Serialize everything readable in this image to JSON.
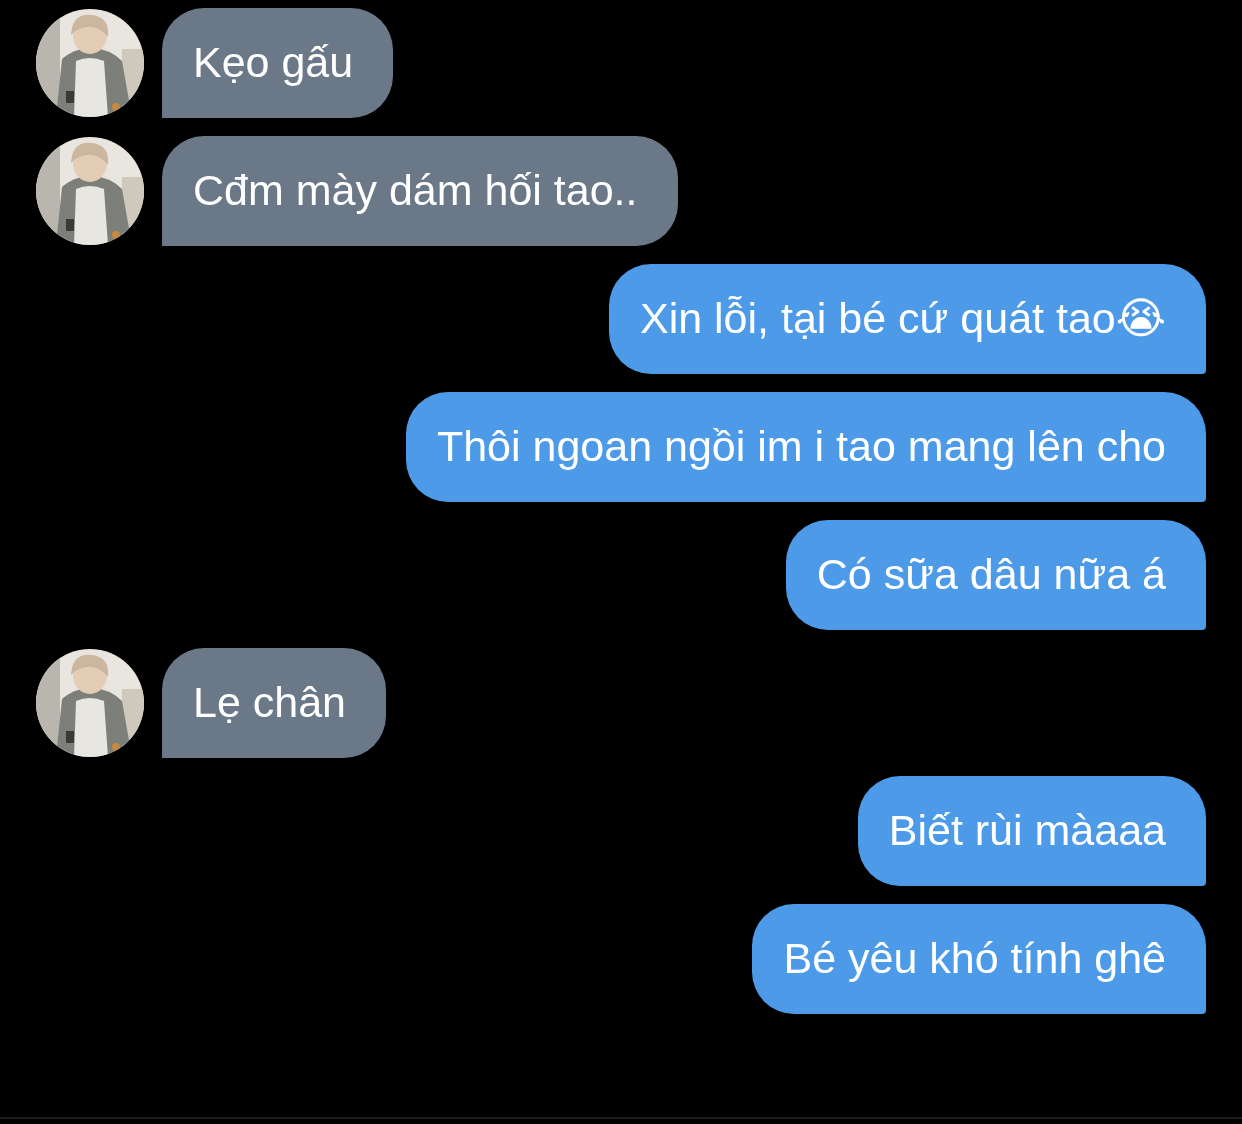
{
  "messages": [
    {
      "outgoing": false,
      "kind": "picture",
      "text": "Kẹo gấu"
    },
    {
      "outgoing": false,
      "kind": "picture",
      "text": "Cđm mày dám hối tao.."
    },
    {
      "outgoing": true,
      "text": "Xin lỗi, tại bé cứ quát tao😭"
    },
    {
      "outgoing": true,
      "text": "Thôi ngoan ngồi im i tao mang lên cho"
    },
    {
      "outgoing": true,
      "text": "Có sữa dâu nữa á"
    },
    {
      "outgoing": false,
      "kind": "picture",
      "text": "Lẹ chân"
    },
    {
      "outgoing": true,
      "text": "Biết rùi màaaa"
    },
    {
      "outgoing": true,
      "text": "Bé yêu khó tính ghê"
    }
  ]
}
